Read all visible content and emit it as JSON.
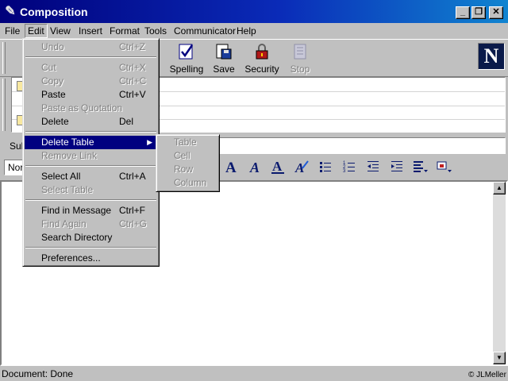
{
  "window": {
    "title": "Composition"
  },
  "menubar": {
    "items": [
      {
        "label": "File"
      },
      {
        "label": "Edit"
      },
      {
        "label": "View"
      },
      {
        "label": "Insert"
      },
      {
        "label": "Format"
      },
      {
        "label": "Tools"
      },
      {
        "label": "Communicator"
      },
      {
        "label": "Help"
      }
    ]
  },
  "toolbar": {
    "buttons": [
      {
        "label": "Spelling",
        "icon": "spelling-icon",
        "enabled": true
      },
      {
        "label": "Save",
        "icon": "save-icon",
        "enabled": true
      },
      {
        "label": "Security",
        "icon": "security-lock-icon",
        "enabled": true
      },
      {
        "label": "Stop",
        "icon": "stop-icon",
        "enabled": false
      }
    ],
    "logo": "N"
  },
  "subject": {
    "label": "Sub",
    "value": ""
  },
  "format_bar": {
    "paragraph_style": "Nor"
  },
  "edit_menu": {
    "items": [
      {
        "label": "Undo",
        "shortcut": "Ctrl+Z",
        "enabled": false
      },
      {
        "label": "Cut",
        "shortcut": "Ctrl+X",
        "enabled": false
      },
      {
        "label": "Copy",
        "shortcut": "Ctrl+C",
        "enabled": false
      },
      {
        "label": "Paste",
        "shortcut": "Ctrl+V",
        "enabled": true
      },
      {
        "label": "Paste as Quotation",
        "shortcut": "",
        "enabled": false
      },
      {
        "label": "Delete",
        "shortcut": "Del",
        "enabled": true
      },
      {
        "label": "Delete Table",
        "shortcut": "",
        "enabled": true,
        "submenu": true,
        "highlighted": true
      },
      {
        "label": "Remove Link",
        "shortcut": "",
        "enabled": false
      },
      {
        "label": "Select All",
        "shortcut": "Ctrl+A",
        "enabled": true
      },
      {
        "label": "Select Table",
        "shortcut": "",
        "enabled": false
      },
      {
        "label": "Find in Message",
        "shortcut": "Ctrl+F",
        "enabled": true
      },
      {
        "label": "Find Again",
        "shortcut": "Ctrl+G",
        "enabled": false
      },
      {
        "label": "Search Directory",
        "shortcut": "",
        "enabled": true
      },
      {
        "label": "Preferences...",
        "shortcut": "",
        "enabled": true
      }
    ]
  },
  "delete_table_submenu": {
    "items": [
      {
        "label": "Table",
        "enabled": false
      },
      {
        "label": "Cell",
        "enabled": false
      },
      {
        "label": "Row",
        "enabled": false
      },
      {
        "label": "Column",
        "enabled": false
      }
    ]
  },
  "statusbar": {
    "text": "Document: Done"
  },
  "watermark": "© JLMeller"
}
